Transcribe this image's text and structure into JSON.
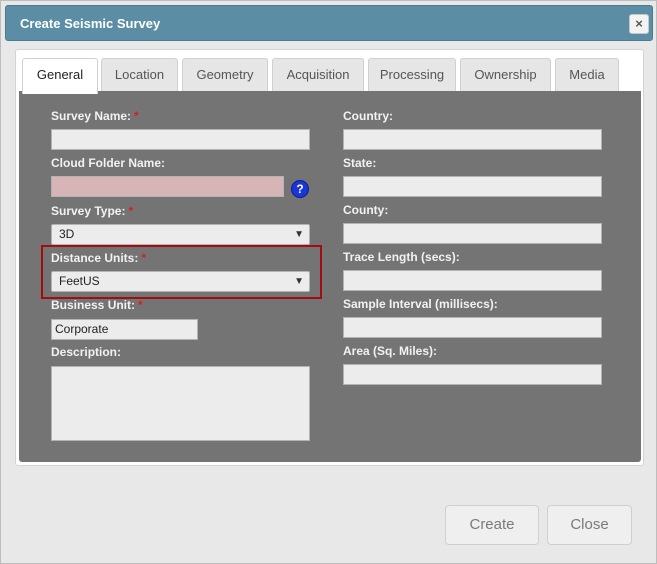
{
  "window": {
    "title": "Create Seismic Survey",
    "close_glyph": "×"
  },
  "tabs": [
    {
      "label": "General",
      "active": true
    },
    {
      "label": "Location"
    },
    {
      "label": "Geometry"
    },
    {
      "label": "Acquisition"
    },
    {
      "label": "Processing"
    },
    {
      "label": "Ownership"
    },
    {
      "label": "Media"
    }
  ],
  "form": {
    "required_marker": "*",
    "survey_name": {
      "label": "Survey Name:",
      "value": "",
      "required": true
    },
    "cloud_folder_name": {
      "label": "Cloud Folder Name:",
      "value": "",
      "help_glyph": "?"
    },
    "survey_type": {
      "label": "Survey Type:",
      "value": "3D",
      "required": true
    },
    "distance_units": {
      "label": "Distance Units:",
      "value": "FeetUS",
      "required": true
    },
    "business_unit": {
      "label": "Business Unit:",
      "value": "Corporate",
      "required": true
    },
    "description": {
      "label": "Description:",
      "value": ""
    },
    "country": {
      "label": "Country:",
      "value": ""
    },
    "state": {
      "label": "State:",
      "value": ""
    },
    "county": {
      "label": "County:",
      "value": ""
    },
    "trace_length": {
      "label": "Trace Length (secs):",
      "value": ""
    },
    "sample_interval": {
      "label": "Sample Interval (millisecs):",
      "value": ""
    },
    "area": {
      "label": "Area (Sq. Miles):",
      "value": ""
    }
  },
  "buttons": {
    "create": "Create",
    "close": "Close"
  },
  "colors": {
    "titlebar": "#5b8ea4",
    "panel": "#747474",
    "required": "#d71f1f",
    "highlight": "#a10e12",
    "help_icon": "#1a36d6",
    "invalid_field": "#d7b5b7"
  }
}
